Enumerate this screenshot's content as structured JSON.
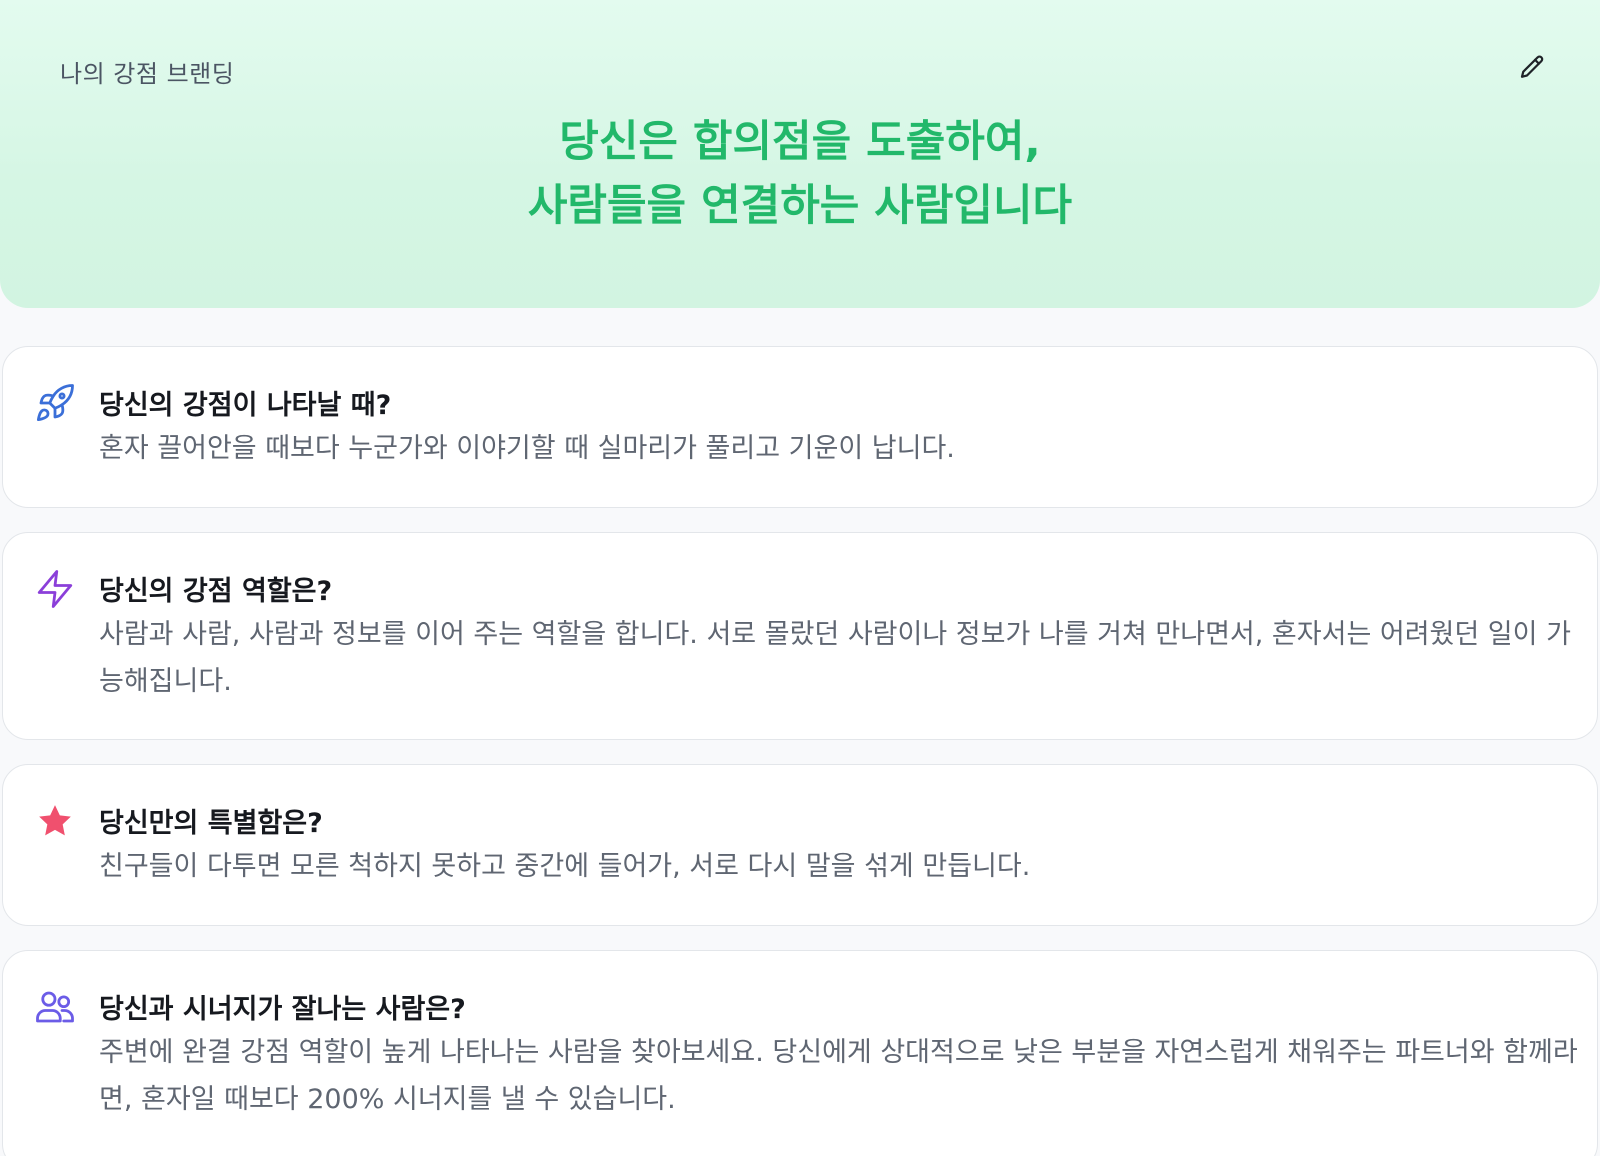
{
  "hero": {
    "label": "나의 강점 브랜딩",
    "headline_line1": "당신은 합의점을 도출하여,",
    "headline_line2": "사람들을 연결하는 사람입니다",
    "accent_color": "#22b86a",
    "edit_icon": "pencil-icon"
  },
  "cards": [
    {
      "icon": "rocket-icon",
      "icon_color": "#3b6fd8",
      "title": "당신의 강점이 나타날 때?",
      "body": "혼자 끌어안을 때보다 누군가와 이야기할 때 실마리가 풀리고 기운이 납니다."
    },
    {
      "icon": "lightning-icon",
      "icon_color": "#8b3fd9",
      "title": "당신의 강점 역할은?",
      "body": "사람과 사람, 사람과 정보를 이어 주는 역할을 합니다. 서로 몰랐던 사람이나 정보가 나를 거쳐 만나면서, 혼자서는 어려웠던 일이 가능해집니다."
    },
    {
      "icon": "star-icon",
      "icon_color": "#f0506e",
      "title": "당신만의 특별함은?",
      "body": "친구들이 다투면 모른 척하지 못하고 중간에 들어가, 서로 다시 말을 섞게 만듭니다."
    },
    {
      "icon": "users-icon",
      "icon_color": "#6b5ce7",
      "title": "당신과 시너지가 잘나는 사람은?",
      "body": "주변에 완결 강점 역할이 높게 나타나는 사람을 찾아보세요. 당신에게 상대적으로 낮은 부분을 자연스럽게 채워주는 파트너와 함께라면, 혼자일 때보다 200% 시너지를 낼 수 있습니다."
    }
  ]
}
